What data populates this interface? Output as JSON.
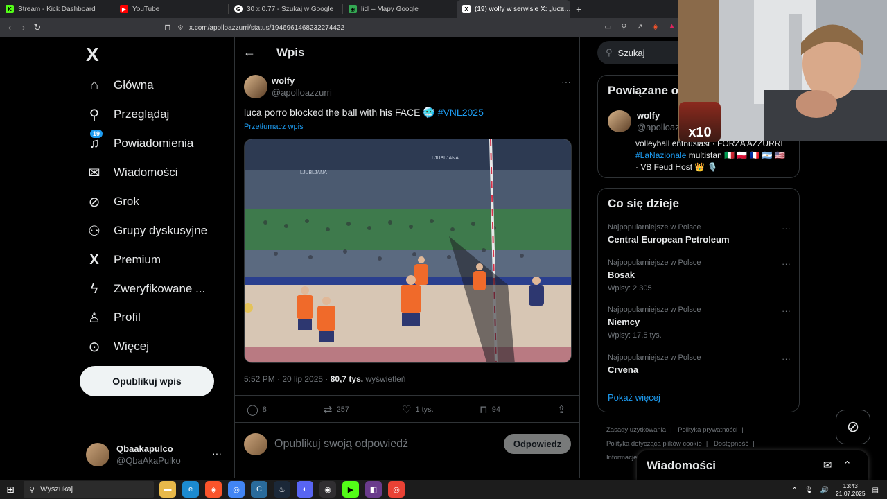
{
  "browser": {
    "tabs": [
      {
        "title": "Stream - Kick Dashboard",
        "icon": "kick-icon",
        "color": "#53fc18",
        "active": false
      },
      {
        "title": "YouTube",
        "icon": "youtube-icon",
        "color": "#ff0000",
        "active": false
      },
      {
        "title": "30 x 0.77 - Szukaj w Google",
        "icon": "google-icon",
        "color": "#ffffff",
        "active": false
      },
      {
        "title": "lidl – Mapy Google",
        "icon": "maps-icon",
        "color": "#34a853",
        "active": false
      },
      {
        "title": "(19) wolfy w serwisie X: „luca…",
        "icon": "x-icon",
        "color": "#ffffff",
        "active": true
      }
    ],
    "url": "x.com/apolloazzurri/status/1946961468232274422"
  },
  "nav": {
    "logo": "X",
    "items": [
      {
        "label": "Główna",
        "icon": "home-icon",
        "glyph": "⌂"
      },
      {
        "label": "Przeglądaj",
        "icon": "search-icon",
        "glyph": "⚲"
      },
      {
        "label": "Powiadomienia",
        "icon": "bell-icon",
        "glyph": "🔔",
        "badge": "19"
      },
      {
        "label": "Wiadomości",
        "icon": "mail-icon",
        "glyph": "✉"
      },
      {
        "label": "Grok",
        "icon": "grok-icon",
        "glyph": "⊘"
      },
      {
        "label": "Grupy dyskusyjne",
        "icon": "communities-icon",
        "glyph": "⚇"
      },
      {
        "label": "Premium",
        "icon": "premium-x-icon",
        "glyph": "X"
      },
      {
        "label": "Zweryfikowane ...",
        "icon": "lightning-icon",
        "glyph": "ϟ"
      },
      {
        "label": "Profil",
        "icon": "profile-icon",
        "glyph": "♙"
      },
      {
        "label": "Więcej",
        "icon": "more-circle-icon",
        "glyph": "⊙"
      }
    ],
    "post_button": "Opublikuj wpis",
    "account": {
      "display_name": "Qbaakapulco",
      "username": "@QbaAkaPulko",
      "more": "···"
    }
  },
  "main": {
    "title": "Wpis",
    "post": {
      "display_name": "wolfy",
      "username": "@apolloazzurri",
      "text": "luca porro blocked the ball with his FACE",
      "emoji": "🥶",
      "hashtag": "#VNL2025",
      "translate": "Przetłumacz wpis",
      "time": "5:52 PM · 20 lip 2025 · ",
      "views_count": "80,7 tys.",
      "views_label": " wyświetleń",
      "banner_text": "LJUBLJANA",
      "banner_text_2": "LJUBLJANA"
    },
    "actions": {
      "replies": "8",
      "reposts": "257",
      "likes": "1 tys.",
      "bookmarks": "94"
    },
    "reply": {
      "placeholder": "Opublikuj swoją odpowiedź",
      "button": "Odpowiedz"
    }
  },
  "right": {
    "search_placeholder": "Szukaj",
    "related": {
      "title": "Powiązane o",
      "user": {
        "display_name": "wolfy",
        "username": "@apolloazz"
      },
      "bio_1": "volleyball enthusiast · FORZA AZZURRI",
      "bio_tag": "#LaNazionale",
      "bio_2": " multistan 🇮🇹 🇵🇱 🇫🇷 🇦🇷 🇺🇸",
      "bio_3": "· VB Feud Host 👑 🎙️"
    },
    "trending": {
      "title": "Co się dzieje",
      "items": [
        {
          "category": "Najpopularniejsze w Polsce",
          "name": "Central European Petroleum",
          "posts": ""
        },
        {
          "category": "Najpopularniejsze w Polsce",
          "name": "Bosak",
          "posts": "Wpisy: 2 305"
        },
        {
          "category": "Najpopularniejsze w Polsce",
          "name": "Niemcy",
          "posts": "Wpisy: 17,5 tys."
        },
        {
          "category": "Najpopularniejsze w Polsce",
          "name": "Crvena",
          "posts": ""
        }
      ],
      "show_more": "Pokaż więcej"
    },
    "footer": [
      "Zasady użytkowania",
      "Polityka prywatności",
      "Polityka dotycząca plików cookie",
      "Dostępność",
      "Informacje"
    ],
    "messages_drawer": "Wiadomości"
  },
  "overlay": {
    "multiplier": "x10"
  },
  "taskbar": {
    "search": "Wyszukaj",
    "time": "13:43",
    "date": "21.07.2025"
  }
}
